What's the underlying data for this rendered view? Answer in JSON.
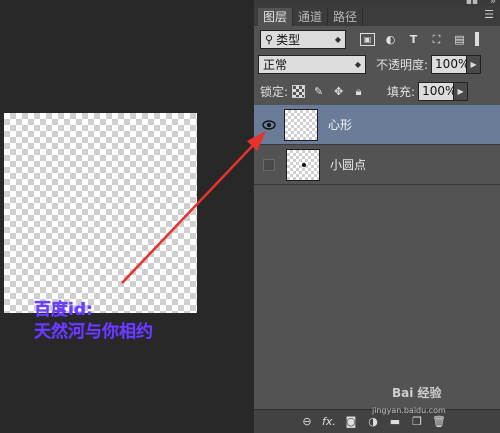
{
  "panel": {
    "tabs": [
      "图层",
      "通道",
      "路径"
    ],
    "filter": {
      "label": "类型"
    },
    "blend_mode": "正常",
    "opacity": {
      "label": "不透明度:",
      "value": "100%"
    },
    "lock_label": "锁定:",
    "fill": {
      "label": "填充:",
      "value": "100%"
    },
    "filter_icons": [
      "image-filter-icon",
      "adjustment-filter-icon",
      "type-filter-icon",
      "shape-filter-icon",
      "smart-object-filter-icon"
    ],
    "lock_icons": [
      "lock-transparent-icon",
      "lock-paint-icon",
      "lock-position-icon",
      "lock-all-icon"
    ],
    "layers": [
      {
        "name": "心形",
        "visible": true,
        "selected": true
      },
      {
        "name": "小圆点",
        "visible": false,
        "selected": false
      }
    ],
    "bottom_icons": [
      "link-icon",
      "fx-icon",
      "mask-icon",
      "adjustment-icon",
      "group-icon",
      "new-layer-icon",
      "trash-icon"
    ],
    "fx_label": "fx."
  },
  "watermark": {
    "line1": "百度id:",
    "line2": "天然河与你相约"
  },
  "brand": {
    "text": "Bai 经验",
    "sub": "jingyan.baidu.com"
  },
  "colors": {
    "selected_layer": "#6b7c98",
    "watermark": "#6a3cff",
    "arrow": "#e8322e"
  }
}
